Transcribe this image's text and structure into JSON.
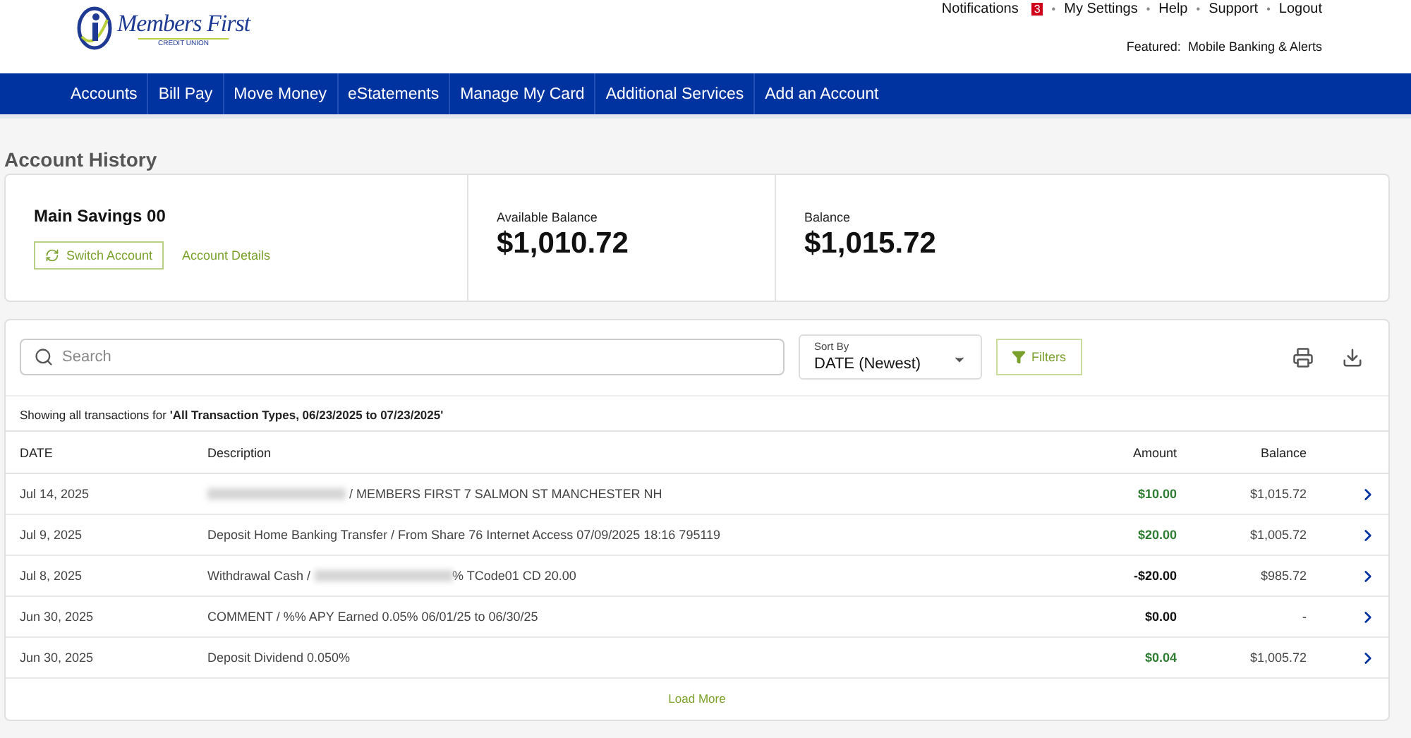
{
  "header": {
    "logo": {
      "name": "Members First",
      "subtitle": "CREDIT UNION"
    },
    "utility_links": [
      {
        "label": "Notifications",
        "badge": "3"
      },
      {
        "separator": "•",
        "label": "My Settings"
      },
      {
        "separator": "•",
        "label": "Help"
      },
      {
        "separator": "•",
        "label": "Support"
      },
      {
        "separator": "•",
        "label": "Logout"
      }
    ],
    "featured": {
      "label": "Featured:",
      "link": "Mobile Banking & Alerts"
    }
  },
  "nav": [
    "Accounts",
    "Bill Pay",
    "Move Money",
    "eStatements",
    "Manage My Card",
    "Additional Services",
    "Add an Account"
  ],
  "page_title": "Account History",
  "account": {
    "name": "Main Savings 00",
    "switch_button": "Switch Account",
    "details_link": "Account Details",
    "balances": [
      {
        "label": "Available Balance",
        "value": "$1,010.72"
      },
      {
        "label": "Balance",
        "value": "$1,015.72"
      }
    ]
  },
  "toolbar": {
    "search": {
      "placeholder": "Search"
    },
    "sort": {
      "label": "Sort By",
      "value": "DATE (Newest)"
    },
    "filters_button": "Filters"
  },
  "summary": {
    "prefix": "Showing all transactions for ",
    "range": "'All Transaction Types, 06/23/2025 to 07/23/2025'"
  },
  "table": {
    "columns": [
      "DATE",
      "Description",
      "Amount",
      "Balance"
    ],
    "rows": [
      {
        "date": "Jul 14, 2025",
        "description": [
          {
            "kind": "redacted"
          },
          {
            "kind": "text",
            "text": " / MEMBERS FIRST 7 SALMON ST MANCHESTER NH"
          }
        ],
        "amount": "$10.00",
        "color": "#2e7d32",
        "balance": "$1,015.72"
      },
      {
        "date": "Jul 9, 2025",
        "description": [
          {
            "kind": "text",
            "text": "Deposit Home Banking Transfer / From Share 76 Internet Access 07/09/2025 18:16 795119"
          }
        ],
        "amount": "$20.00",
        "color": "#2e7d32",
        "balance": "$1,005.72"
      },
      {
        "date": "Jul 8, 2025",
        "description": [
          {
            "kind": "text",
            "text": "Withdrawal Cash / "
          },
          {
            "kind": "redacted"
          },
          {
            "kind": "text",
            "text": "% TCode01 CD 20.00"
          }
        ],
        "amount": "-$20.00",
        "color": "#111111",
        "balance": "$985.72"
      },
      {
        "date": "Jun 30, 2025",
        "description": [
          {
            "kind": "text",
            "text": "COMMENT / %% APY Earned 0.05% 06/01/25 to 06/30/25"
          }
        ],
        "amount": "$0.00",
        "color": "#111111",
        "balance": "-"
      },
      {
        "date": "Jun 30, 2025",
        "description": [
          {
            "kind": "text",
            "text": "Deposit Dividend 0.050%"
          }
        ],
        "amount": "$0.04",
        "color": "#2e7d32",
        "balance": "$1,005.72"
      }
    ]
  },
  "load_more": "Load More"
}
